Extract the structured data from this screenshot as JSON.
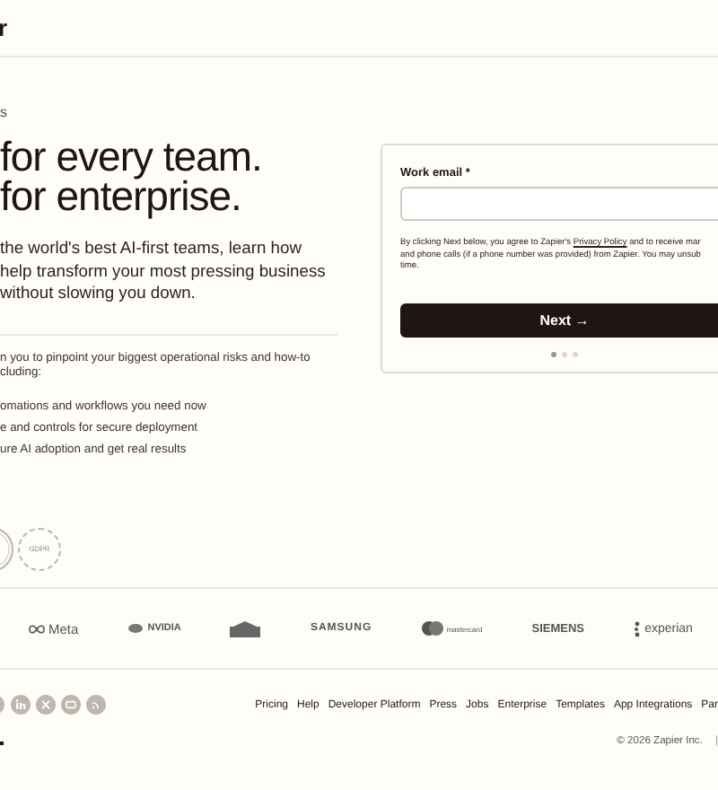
{
  "header": {
    "logo_fragment": "r"
  },
  "hero": {
    "eyebrow": "s",
    "heading_lines": [
      "for every team.",
      "for enterprise."
    ],
    "intro_lines": [
      "the world's best AI-first teams, learn how",
      "help transform your most pressing business",
      "without slowing you down."
    ],
    "detail_lines": [
      "n you to pinpoint your biggest operational risks and how-to",
      "cluding:"
    ],
    "bullets": [
      "omations and workflows you need now",
      "e and controls for secure deployment",
      "ure AI adoption and get real results"
    ],
    "badges": [
      {
        "kind": "partial"
      },
      {
        "kind": "gdpr",
        "label": "GDPR"
      }
    ]
  },
  "form": {
    "label": "Work email *",
    "consent_before": "By clicking Next below, you agree to Zapier's ",
    "consent_link": "Privacy Policy",
    "consent_after": " and to receive mar",
    "consent_lines": [
      "and phone calls (if a phone number was provided) from Zapier. You may unsub",
      "time."
    ],
    "button": "Next →",
    "steps": [
      {
        "selected": true
      },
      {
        "selected": false
      },
      {
        "selected": false
      }
    ]
  },
  "logos": [
    {
      "kind": "meta",
      "text": "Meta"
    },
    {
      "kind": "nvidia",
      "text": "NVIDIA"
    },
    {
      "kind": "lowes"
    },
    {
      "kind": "samsung",
      "text": "SAMSUNG"
    },
    {
      "kind": "mastercard",
      "text": "mastercard"
    },
    {
      "kind": "siemens",
      "text": "SIEMENS"
    },
    {
      "kind": "experian",
      "text": "experian"
    }
  ],
  "footer": {
    "social": [
      {
        "kind": "linkedin"
      },
      {
        "kind": "x"
      },
      {
        "kind": "youtube"
      },
      {
        "kind": "rss"
      }
    ],
    "links": [
      "Pricing",
      "Help",
      "Developer Platform",
      "Press",
      "Jobs",
      "Enterprise",
      "Templates",
      "App Integrations",
      "Par"
    ],
    "copyright": "© 2026 Zapier Inc.",
    "separator": "|"
  }
}
